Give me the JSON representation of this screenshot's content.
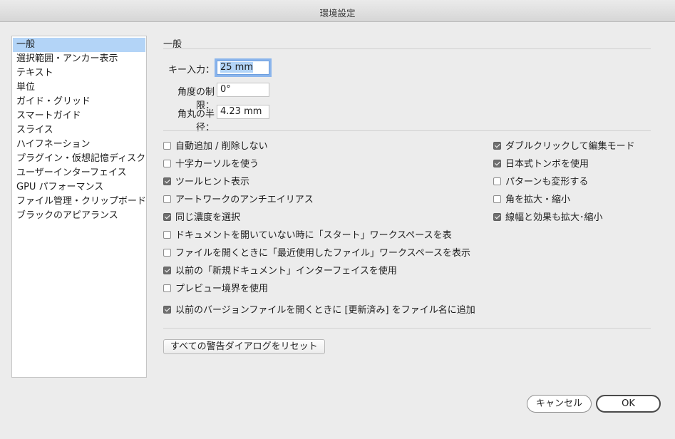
{
  "window": {
    "title": "環境設定"
  },
  "sidebar": {
    "items": [
      {
        "label": "一般",
        "selected": true
      },
      {
        "label": "選択範囲・アンカー表示"
      },
      {
        "label": "テキスト"
      },
      {
        "label": "単位"
      },
      {
        "label": "ガイド・グリッド"
      },
      {
        "label": "スマートガイド"
      },
      {
        "label": "スライス"
      },
      {
        "label": "ハイフネーション"
      },
      {
        "label": "プラグイン・仮想記憶ディスク"
      },
      {
        "label": "ユーザーインターフェイス"
      },
      {
        "label": "GPU パフォーマンス"
      },
      {
        "label": "ファイル管理・クリップボード"
      },
      {
        "label": "ブラックのアピアランス"
      }
    ]
  },
  "main": {
    "section_title": "一般",
    "fields": {
      "key_increment": {
        "label": "キー入力：",
        "value": "25 mm"
      },
      "constrain_angle": {
        "label": "角度の制限：",
        "value": "0°"
      },
      "corner_radius": {
        "label": "角丸の半径：",
        "value": "4.23 mm"
      }
    },
    "checkboxes_left": [
      {
        "label": "自動追加 / 削除しない",
        "checked": false
      },
      {
        "label": "十字カーソルを使う",
        "checked": false
      },
      {
        "label": "ツールヒント表示",
        "checked": true
      },
      {
        "label": "アートワークのアンチエイリアス",
        "checked": false
      },
      {
        "label": "同じ濃度を選択",
        "checked": true
      },
      {
        "label": "ドキュメントを開いていない時に「スタート」ワークスペースを表",
        "checked": false
      },
      {
        "label": "ファイルを開くときに「最近使用したファイル」ワークスペースを表示",
        "checked": false
      },
      {
        "label": "以前の「新規ドキュメント」インターフェイスを使用",
        "checked": true
      },
      {
        "label": "プレビュー境界を使用",
        "checked": false
      },
      {
        "label": "以前のバージョンファイルを開くときに [更新済み] をファイル名に追加",
        "checked": true
      }
    ],
    "checkboxes_right": [
      {
        "label": "ダブルクリックして編集モード",
        "checked": true
      },
      {
        "label": "日本式トンボを使用",
        "checked": true
      },
      {
        "label": "パターンも変形する",
        "checked": false
      },
      {
        "label": "角を拡大・縮小",
        "checked": false
      },
      {
        "label": "線幅と効果も拡大･縮小",
        "checked": true
      }
    ],
    "reset_button": "すべての警告ダイアログをリセット"
  },
  "footer": {
    "cancel_label": "キャンセル",
    "ok_label": "OK"
  }
}
